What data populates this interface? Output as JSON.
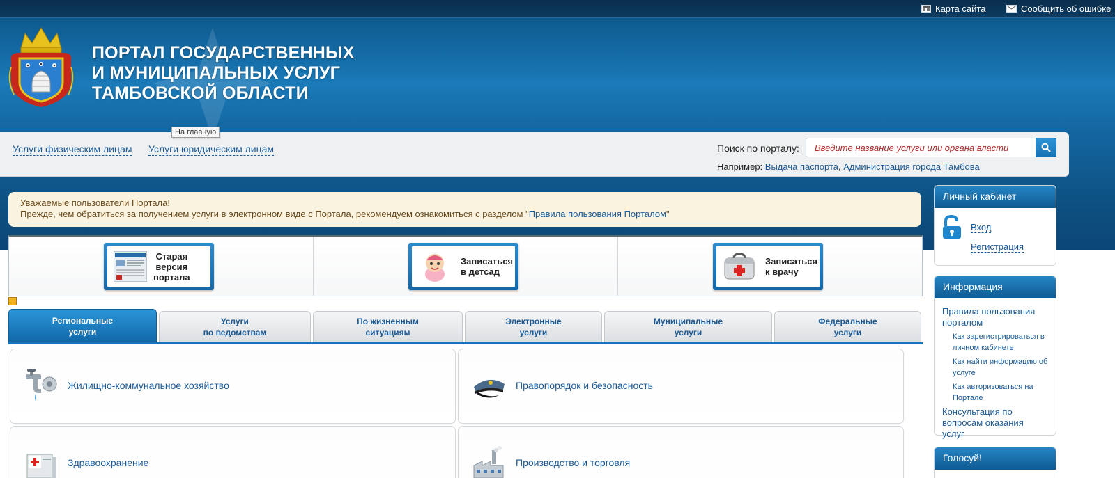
{
  "header": {
    "site_map": "Карта сайта",
    "report_error": "Сообщить об ошибке",
    "title_lines": [
      "ПОРТАЛ ГОСУДАРСТВЕННЫХ",
      "И МУНИЦИПАЛЬНЫХ УСЛУГ",
      "ТАМБОВСКОЙ ОБЛАСТИ"
    ],
    "tooltip": "На главную"
  },
  "nav": {
    "individuals": "Услуги физическим лицам",
    "legal": "Услуги юридическим лицам"
  },
  "search": {
    "label": "Поиск по порталу:",
    "placeholder": "Введите название услуги или органа власти",
    "example_prefix": "Например:",
    "example_1": "Выдача паспорта",
    "example_sep": ",",
    "example_2": "Администрация города Тамбова"
  },
  "notice": {
    "line1": "Уважаемые пользователи Портала!",
    "line2_prefix": "Прежде, чем обратиться за получением услуги в электронном виде с Портала, рекомендуем ознакомиться с разделом \"",
    "line2_link": "Правила пользования Порталом",
    "line2_suffix": "\""
  },
  "banners": [
    {
      "lines": [
        "Старая",
        "версия",
        "портала"
      ],
      "icon": "old-portal-thumbnail"
    },
    {
      "lines": [
        "Записаться",
        "в детсад"
      ],
      "icon": "baby-icon"
    },
    {
      "lines": [
        "Записаться",
        "к врачу"
      ],
      "icon": "medical-bag-icon"
    }
  ],
  "tabs": [
    {
      "l1": "Региональные",
      "l2": "услуги",
      "active": true
    },
    {
      "l1": "Услуги",
      "l2": "по ведомствам"
    },
    {
      "l1": "По жизненным",
      "l2": "ситуациям"
    },
    {
      "l1": "Электронные",
      "l2": "услуги"
    },
    {
      "l1": "Муниципальные",
      "l2": "услуги"
    },
    {
      "l1": "Федеральные",
      "l2": "услуги"
    }
  ],
  "categories": [
    {
      "label": "Жилищно-коммунальное хозяйство",
      "icon": "water-tap-icon"
    },
    {
      "label": "Правопорядок и безопасность",
      "icon": "police-cap-icon"
    },
    {
      "label": "Здравоохранение",
      "icon": "first-aid-kit-icon"
    },
    {
      "label": "Производство и торговля",
      "icon": "factory-icon"
    }
  ],
  "sidebar": {
    "cabinet": {
      "title": "Личный кабинет",
      "login": "Вход",
      "register": "Регистрация"
    },
    "info": {
      "title": "Информация",
      "rules": "Правила пользования порталом",
      "sub1": "Как зарегистрироваться в личном кабинете",
      "sub2": "Как найти информацию об услуге",
      "sub3": "Как авторизоваться на Портале",
      "consult": "Консультация по вопросам оказания услуг"
    },
    "vote": {
      "title": "Голосуй!"
    }
  },
  "colors": {
    "brand_blue": "#1576bb",
    "header_dark": "#0b3e66",
    "notice_bg": "#faf3df"
  }
}
